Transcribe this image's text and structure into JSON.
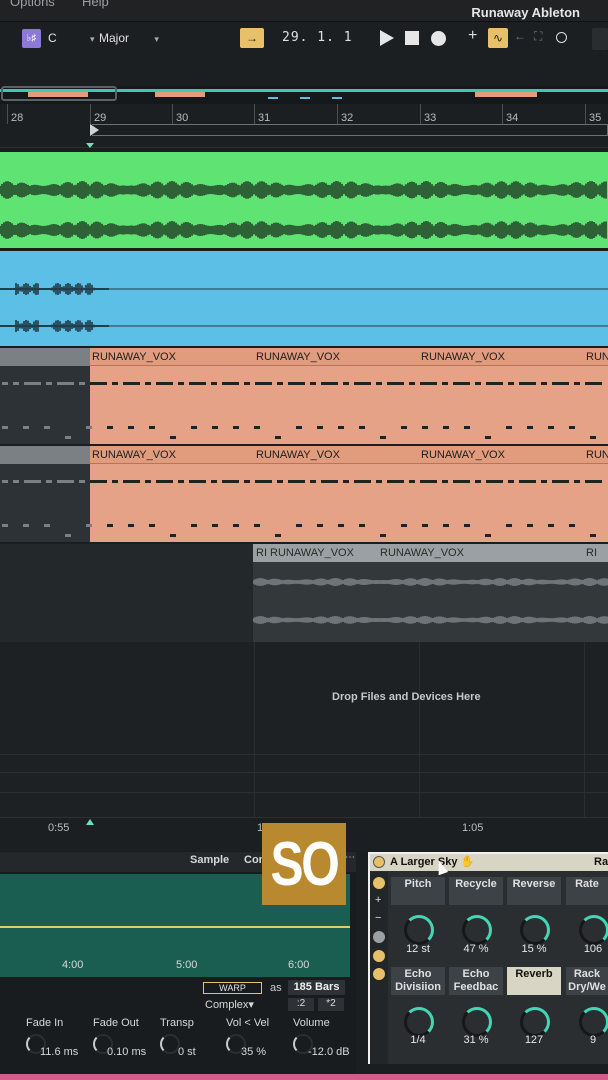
{
  "app": {
    "title": "Runaway Ableton",
    "menu": [
      "Options",
      "Help"
    ]
  },
  "transport": {
    "key": "C",
    "scale": "Major",
    "position": "29.  1.  1"
  },
  "ruler": {
    "bars": [
      "28",
      "29",
      "30",
      "31",
      "32",
      "33",
      "34",
      "35"
    ]
  },
  "tracks": {
    "vox_clip_name": "RUNAWAY_VOX",
    "audio_clip_prefix": "RI",
    "drop_text": "Drop Files and Devices Here"
  },
  "time_ruler": [
    "0:55",
    "1",
    "1:05"
  ],
  "clip_view": {
    "tabs": [
      "Sample",
      "Con"
    ],
    "timestamps": [
      "4:00",
      "5:00",
      "6:00"
    ],
    "warp_label": "WARP",
    "as_label": "as",
    "bars_value": "185 Bars",
    "warp_mode": "Complex",
    "half": ":2",
    "double": "*2",
    "params": [
      {
        "label": "Fade In",
        "value": "11.6 ms"
      },
      {
        "label": "Fade Out",
        "value": "0.10 ms"
      },
      {
        "label": "Transp",
        "value": "0 st"
      },
      {
        "label": "Vol < Vel",
        "value": "35 %"
      },
      {
        "label": "Volume",
        "value": "-12.0 dB"
      }
    ]
  },
  "caption": {
    "text": "SO"
  },
  "rack": {
    "name": "A Larger Sky",
    "right_label": "Ra",
    "macros": [
      {
        "label": "Pitch",
        "value": "12 st"
      },
      {
        "label": "Recycle",
        "value": "47 %"
      },
      {
        "label": "Reverse",
        "value": "15 %"
      },
      {
        "label": "Rate",
        "value": "106"
      },
      {
        "label": "Echo Divisiion",
        "value": "1/4"
      },
      {
        "label": "Echo Feedbac",
        "value": "31 %"
      },
      {
        "label": "Reverb",
        "value": "127"
      },
      {
        "label": "Rack Dry/We",
        "value": "9"
      }
    ]
  },
  "colors": {
    "green_track": "#5fe373",
    "blue_track": "#5cbfe6",
    "vox_clip": "#e5a286",
    "accent": "#e8c06a",
    "knob_ring": "#43d6b5"
  }
}
